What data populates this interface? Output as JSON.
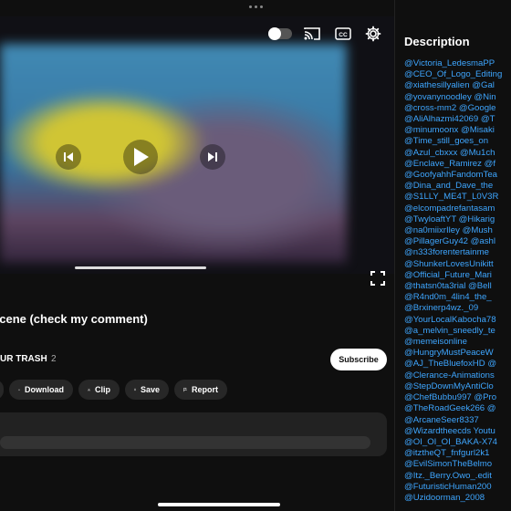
{
  "video": {
    "title": "scene (check my comment)",
    "channel": "UR TRASH",
    "subscriber_count": "2",
    "progress": 0.5
  },
  "actions": {
    "subscribe": "Subscribe",
    "download": "Download",
    "clip": "Clip",
    "save": "Save",
    "report": "Report"
  },
  "player_icons": [
    "autoplay-toggle",
    "cast-icon",
    "captions-icon",
    "settings-gear-icon",
    "play-icon",
    "previous-icon",
    "next-icon",
    "fullscreen-icon"
  ],
  "description": {
    "heading": "Description",
    "mentions": [
      "@Victoria_LedesmaPP",
      "@CEO_Of_Logo_Editing",
      "@xiathesillyalien @Gal",
      "@yovanynoodley @Nin",
      "@cross-mm2 @Google",
      "@AliAlhazmi42069 @T",
      "@minumoonx @Misaki",
      "@Time_still_goes_on",
      "@Azul_cbxxx @Mu1ch",
      "@Enclave_Ramirez @f",
      "@GoofyahhFandomTea",
      "@Dina_and_Dave_the",
      "@S1LLY_ME4T_L0V3R",
      "@elcompadrefantasam",
      "@TwyloaftYT @Hikarig",
      "@na0miixrIley @Mush",
      "@PillagerGuy42 @ashl",
      "@n333forentertainme",
      "@ShunkerLovesUnikitt",
      "@Official_Future_Mari",
      "@thatsn0ta3rial @Bell",
      "@R4nd0m_4lin4_the_",
      "@Brxinerp4wz._09",
      "@YourLocalKabocha78",
      "@a_melvin_sneedly_te",
      "@memeisonline",
      "@HungryMustPeaceW",
      "@AJ_TheBluefoxHD @",
      "@Clerance-Animations",
      "@StepDownMyAntiClo",
      "@ChefBubbu997 @Pro",
      "@TheRoadGeek266 @",
      "@ArcaneSeer8337",
      "@Wizardtheecds Youtu",
      "@OI_OI_OI_BAKA-X74",
      "@itztheQT_fnfgurl2k1",
      "@EvilSimonTheBelmo",
      "@Itz._Berry.Owo_.edit",
      "@FuturisticHuman200",
      "@Uzidoorman_2008"
    ]
  }
}
